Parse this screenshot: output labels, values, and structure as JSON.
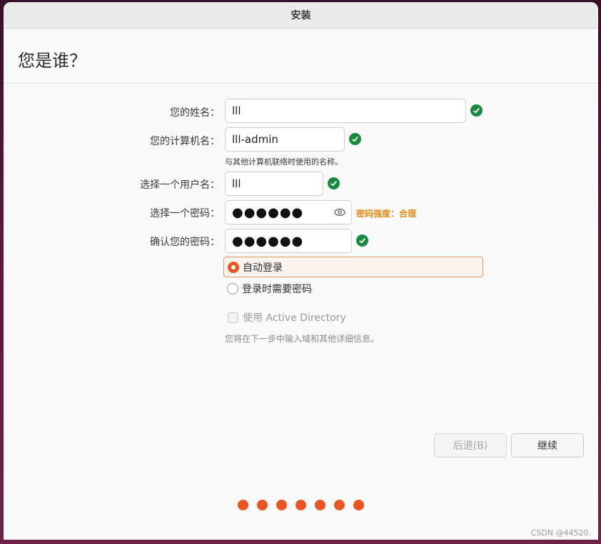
{
  "window": {
    "title": "安装"
  },
  "page": {
    "title": "您是谁？"
  },
  "form": {
    "name": {
      "label": "您的姓名：",
      "value": "lll",
      "valid": true
    },
    "computer": {
      "label": "您的计算机名：",
      "value": "lll-admin",
      "hint": "与其他计算机联络时使用的名称。",
      "valid": true
    },
    "username": {
      "label": "选择一个用户名：",
      "value": "lll",
      "valid": true
    },
    "password": {
      "label": "选择一个密码：",
      "value": "●●●●●●",
      "strength": "密码强度：合理"
    },
    "confirm": {
      "label": "确认您的密码：",
      "value": "●●●●●●",
      "valid": true
    }
  },
  "login_options": {
    "auto_login": {
      "label": "自动登录",
      "selected": true
    },
    "require_password": {
      "label": "登录时需要密码",
      "selected": false
    },
    "active_directory": {
      "label": "使用 Active Directory",
      "checked": false,
      "note": "您将在下一步中输入域和其他详细信息。"
    }
  },
  "buttons": {
    "back": "后退(B)",
    "continue": "继续"
  },
  "progress": {
    "total_steps": 7
  },
  "accent_color": "#e95420",
  "valid_color": "#188a3e",
  "watermark": "CSDN @44520."
}
